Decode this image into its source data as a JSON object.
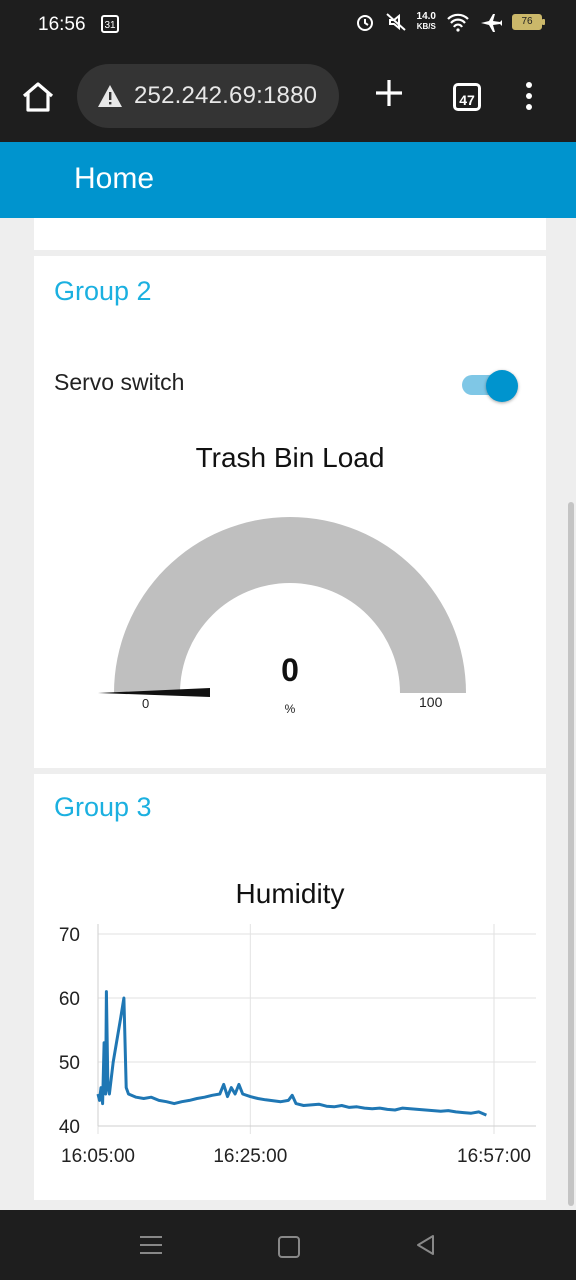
{
  "status_bar": {
    "time": "16:56",
    "calendar_day": "31",
    "net_speed_value": "14.0",
    "net_speed_unit": "KB/S",
    "battery": "76"
  },
  "browser": {
    "url": "252.242.69:1880",
    "tab_count": "47"
  },
  "app": {
    "title": "Home"
  },
  "group2": {
    "title": "Group 2",
    "switch_label": "Servo switch",
    "switch_on": true,
    "gauge": {
      "title": "Trash Bin Load",
      "value": "0",
      "units": "%",
      "min": "0",
      "max": "100"
    }
  },
  "group3": {
    "title": "Group 3"
  },
  "chart_data": {
    "type": "line",
    "title": "Humidity",
    "xlabel": "",
    "ylabel": "",
    "ylim": [
      40,
      70
    ],
    "yticks": [
      "70",
      "60",
      "50",
      "40"
    ],
    "xticks": [
      "16:05:00",
      "16:25:00",
      "16:57:00"
    ],
    "xlim_minutes": [
      0,
      52
    ],
    "grid": true,
    "series": [
      {
        "color": "#1f77b4",
        "x": [
          0,
          0.2,
          0.4,
          0.6,
          0.8,
          1.0,
          1.1,
          1.3,
          1.5,
          2.0,
          3.0,
          3.4,
          3.7,
          4.0,
          5,
          6,
          7,
          8,
          9,
          10,
          11,
          12,
          13,
          14,
          15,
          16,
          16.5,
          17,
          17.5,
          18,
          18.5,
          19,
          20,
          21,
          22,
          24,
          25,
          25.5,
          26,
          27,
          28,
          29,
          30,
          31,
          32,
          33,
          34,
          35,
          36,
          37,
          38,
          39,
          40,
          41,
          42,
          43,
          44,
          45,
          46,
          47,
          48,
          49,
          50,
          51
        ],
        "y": [
          45,
          44,
          46,
          43.5,
          53,
          45,
          61,
          46,
          45,
          50,
          57,
          60,
          46,
          45,
          44.5,
          44.3,
          44.5,
          44,
          43.8,
          43.5,
          43.8,
          44,
          44.3,
          44.5,
          44.8,
          45,
          46.5,
          44.6,
          46,
          45,
          46.5,
          45,
          44.6,
          44.3,
          44.1,
          43.8,
          44.0,
          44.8,
          43.5,
          43.2,
          43.3,
          43.4,
          43.1,
          43.0,
          43.2,
          42.9,
          43.0,
          42.8,
          42.7,
          42.8,
          42.6,
          42.5,
          42.8,
          42.7,
          42.6,
          42.5,
          42.4,
          42.3,
          42.4,
          42.2,
          42.1,
          42.0,
          42.2,
          41.7
        ]
      }
    ]
  }
}
